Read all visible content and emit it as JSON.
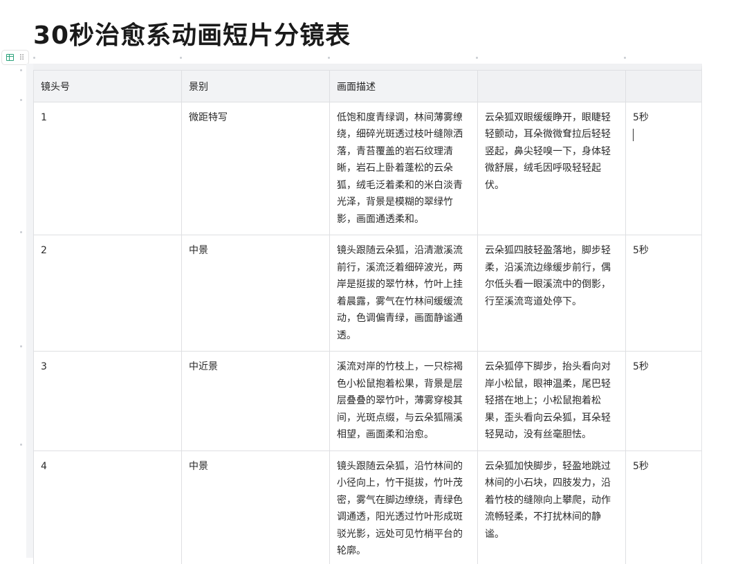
{
  "title": "30秒治愈系动画短片分镜表",
  "table": {
    "headers": [
      "镜头号",
      "景别",
      "画面描述",
      "",
      ""
    ],
    "rows": [
      {
        "shot": "1",
        "scale": "微距特写",
        "description": "低饱和度青绿调，林间薄雾缭绕，细碎光斑透过枝叶缝隙洒落，青苔覆盖的岩石纹理清晰，岩石上卧着蓬松的云朵狐，绒毛泛着柔和的米白淡青光泽，背景是模糊的翠绿竹影，画面通透柔和。",
        "action": "云朵狐双眼缓缓睁开，眼睫轻轻颤动，耳朵微微耷拉后轻轻竖起，鼻尖轻嗅一下，身体轻微舒展，绒毛因呼吸轻轻起伏。",
        "duration": "5秒"
      },
      {
        "shot": "2",
        "scale": "中景",
        "description": "镜头跟随云朵狐，沿清澈溪流前行，溪流泛着细碎波光，两岸是挺拔的翠竹林，竹叶上挂着晨露，雾气在竹林间缓缓流动，色调偏青绿，画面静谧通透。",
        "action": "云朵狐四肢轻盈落地，脚步轻柔，沿溪流边缘缓步前行，偶尔低头看一眼溪流中的倒影，行至溪流弯道处停下。",
        "duration": "5秒"
      },
      {
        "shot": "3",
        "scale": "中近景",
        "description": "溪流对岸的竹枝上，一只棕褐色小松鼠抱着松果，背景是层层叠叠的翠竹叶，薄雾穿梭其间，光斑点缀，与云朵狐隔溪相望，画面柔和治愈。",
        "action": "云朵狐停下脚步，抬头看向对岸小松鼠，眼神温柔，尾巴轻轻搭在地上；小松鼠抱着松果，歪头看向云朵狐，耳朵轻轻晃动，没有丝毫胆怯。",
        "duration": "5秒"
      },
      {
        "shot": "4",
        "scale": "中景",
        "description": "镜头跟随云朵狐，沿竹林间的小径向上，竹干挺拔，竹叶茂密，雾气在脚边缭绕，青绿色调通透，阳光透过竹叶形成斑驳光影，远处可见竹梢平台的轮廓。",
        "action": "云朵狐加快脚步，轻盈地跳过林间的小石块，四肢发力，沿着竹枝的缝隙向上攀爬，动作流畅轻柔，不打扰林间的静谧。",
        "duration": "5秒"
      }
    ]
  }
}
